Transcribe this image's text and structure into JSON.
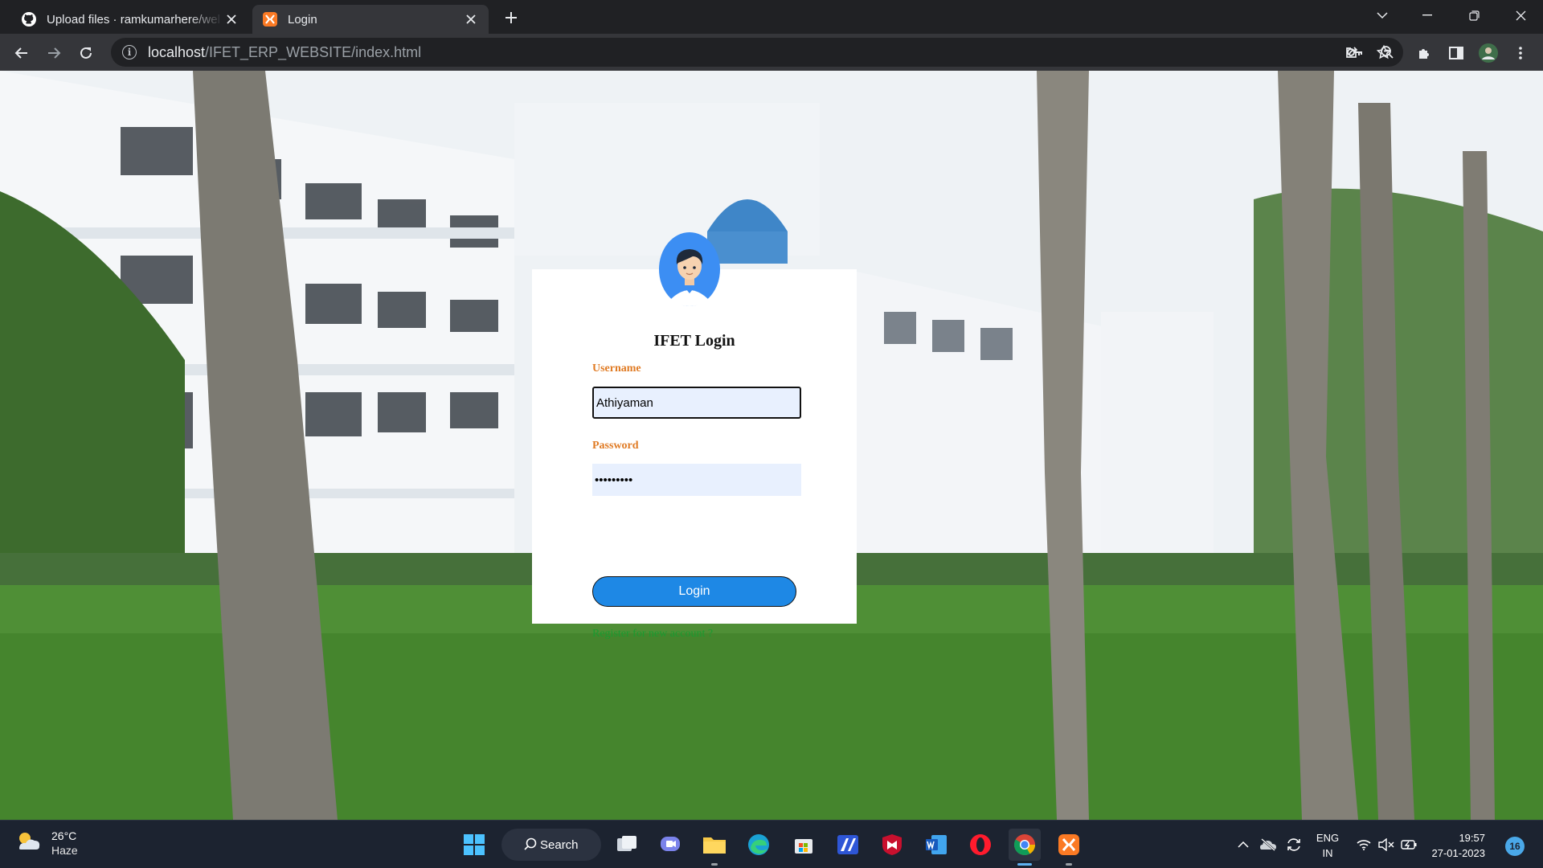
{
  "browser": {
    "tabs": [
      {
        "title": "Upload files · ramkumarhere/wel",
        "favicon": "github-icon",
        "active": false
      },
      {
        "title": "Login",
        "favicon": "xampp-icon",
        "active": true
      }
    ],
    "address": {
      "host": "localhost",
      "path": "/IFET_ERP_WEBSITE/index.html"
    },
    "toolbar_icons": [
      "back-icon",
      "forward-icon",
      "reload-icon",
      "key-icon",
      "zoom-icon",
      "share-icon",
      "star-icon",
      "extensions-icon",
      "sidepanel-icon",
      "profile-avatar",
      "menu-icon"
    ]
  },
  "login": {
    "title": "IFET Login",
    "username_label": "Username",
    "username_value": "Athiyaman",
    "password_label": "Password",
    "password_value": "•••••••••",
    "button_label": "Login",
    "register_link": "Register for new account ?"
  },
  "taskbar": {
    "weather": {
      "temp": "26°C",
      "condition": "Haze"
    },
    "search_label": "Search",
    "apps": [
      "windows-start-icon",
      "task-view-icon",
      "teams-chat-icon",
      "file-explorer-icon",
      "edge-icon",
      "store-icon",
      "app-icon",
      "mcafee-icon",
      "word-icon",
      "opera-icon",
      "chrome-icon",
      "xampp-icon"
    ],
    "language": {
      "line1": "ENG",
      "line2": "IN"
    },
    "clock": {
      "time": "19:57",
      "date": "27-01-2023"
    },
    "notification_count": "16"
  },
  "colors": {
    "label_orange": "#e07b24",
    "login_button_blue": "#1e88e5",
    "register_green": "#1a9a30",
    "input_fill": "#e8f0fe"
  }
}
